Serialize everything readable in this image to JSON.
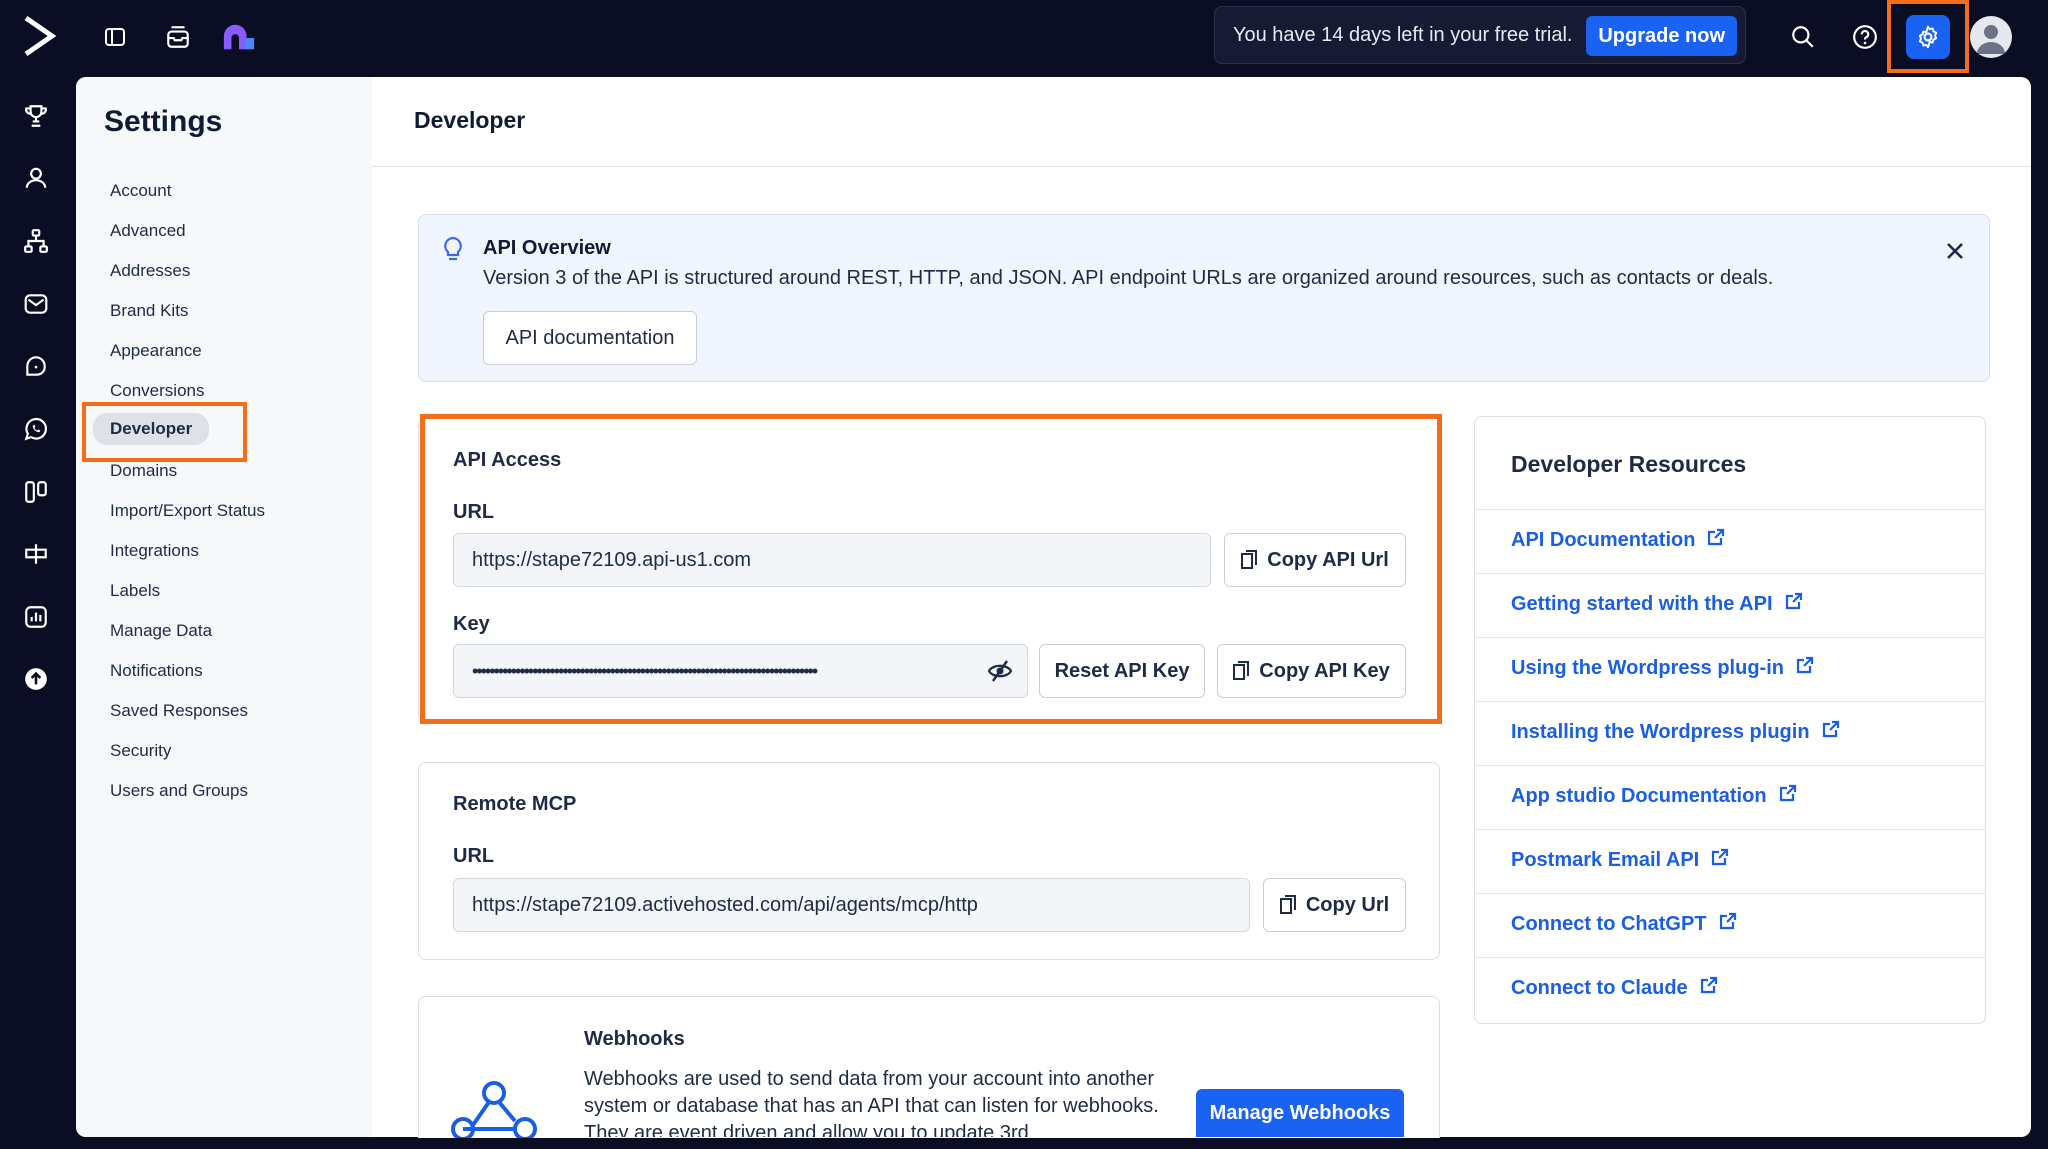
{
  "topbar": {
    "trial_text": "You have 14 days left in your free trial.",
    "upgrade_label": "Upgrade now",
    "icons": [
      "sidebar-toggle-icon",
      "inbox-icon",
      "apps-icon",
      "search-icon",
      "help-icon",
      "gear-icon",
      "avatar"
    ]
  },
  "rail": {
    "icons": [
      "trophy-icon",
      "contacts-icon",
      "automations-icon",
      "email-icon",
      "conversations-icon",
      "whatsapp-icon",
      "pipelines-icon",
      "site-icon",
      "reports-icon",
      "upgrade-icon"
    ]
  },
  "settings": {
    "title": "Settings",
    "nav": [
      {
        "label": "Account",
        "active": false
      },
      {
        "label": "Advanced",
        "active": false
      },
      {
        "label": "Addresses",
        "active": false
      },
      {
        "label": "Brand Kits",
        "active": false
      },
      {
        "label": "Appearance",
        "active": false
      },
      {
        "label": "Conversions",
        "active": false
      },
      {
        "label": "Developer",
        "active": true
      },
      {
        "label": "Domains",
        "active": false
      },
      {
        "label": "Import/Export Status",
        "active": false
      },
      {
        "label": "Integrations",
        "active": false
      },
      {
        "label": "Labels",
        "active": false
      },
      {
        "label": "Manage Data",
        "active": false
      },
      {
        "label": "Notifications",
        "active": false
      },
      {
        "label": "Saved Responses",
        "active": false
      },
      {
        "label": "Security",
        "active": false
      },
      {
        "label": "Users and Groups",
        "active": false
      }
    ]
  },
  "page": {
    "title": "Developer"
  },
  "overview": {
    "title": "API Overview",
    "body": "Version 3 of the API is structured around REST, HTTP, and JSON. API endpoint URLs are organized around resources, such as contacts or deals.",
    "doc_button": "API documentation"
  },
  "api_access": {
    "title": "API Access",
    "url_label": "URL",
    "url_value": "https://stape72109.api-us1.com",
    "copy_url_label": "Copy API Url",
    "key_label": "Key",
    "key_value": "••••••••••••••••••••••••••••••••••••••••••••••••••••••••••••••••••••••••••••••••",
    "reset_label": "Reset API Key",
    "copy_key_label": "Copy API Key"
  },
  "remote_mcp": {
    "title": "Remote MCP",
    "url_label": "URL",
    "url_value": "https://stape72109.activehosted.com/api/agents/mcp/http",
    "copy_label": "Copy Url"
  },
  "webhooks": {
    "title": "Webhooks",
    "body": "Webhooks are used to send data from your account into another system or database that has an API that can listen for webhooks. They are event driven and allow you to update 3rd",
    "manage_label": "Manage Webhooks"
  },
  "resources": {
    "title": "Developer Resources",
    "links": [
      "API Documentation",
      "Getting started with the API",
      "Using the Wordpress plug-in",
      "Installing the Wordpress plugin",
      "App studio Documentation",
      "Postmark Email API",
      "Connect to ChatGPT",
      "Connect to Claude"
    ]
  },
  "colors": {
    "accent": "#1a62f1",
    "highlight": "#f36d1b",
    "sidebar_bg": "#0b0d24",
    "link": "#1a5fe3"
  }
}
